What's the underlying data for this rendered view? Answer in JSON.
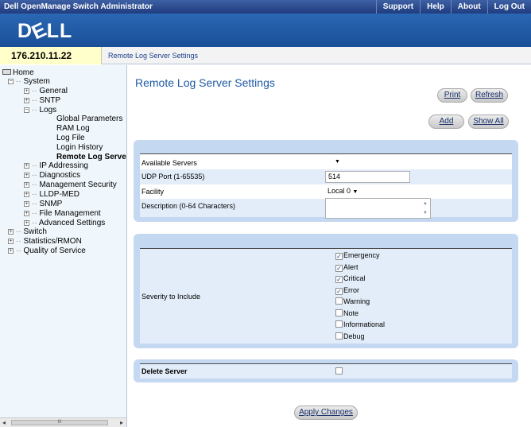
{
  "topbar": {
    "title": "Dell OpenManage Switch Administrator",
    "links": [
      "Support",
      "Help",
      "About",
      "Log Out"
    ]
  },
  "logo": "DELL",
  "ip": "176.210.11.22",
  "breadcrumb": "Remote Log Server Settings",
  "tree": {
    "home": "Home",
    "system": "System",
    "general": "General",
    "sntp": "SNTP",
    "logs": "Logs",
    "global_parameters": "Global Parameters",
    "ram_log": "RAM Log",
    "log_file": "Log File",
    "login_history": "Login History",
    "remote_log_server": "Remote Log Serve",
    "ip_addressing": "IP Addressing",
    "diagnostics": "Diagnostics",
    "management_security": "Management Security",
    "lldp_med": "LLDP-MED",
    "snmp": "SNMP",
    "file_management": "File Management",
    "advanced_settings": "Advanced Settings",
    "switch": "Switch",
    "statistics_rmon": "Statistics/RMON",
    "quality_of_service": "Quality of Service"
  },
  "main": {
    "title": "Remote Log Server Settings",
    "buttons": {
      "print": "Print",
      "refresh": "Refresh",
      "add": "Add",
      "show_all": "Show All",
      "apply": "Apply Changes"
    }
  },
  "form": {
    "available_servers_label": "Available Servers",
    "available_servers_value": "",
    "udp_port_label": "UDP Port (1-65535)",
    "udp_port_value": "514",
    "facility_label": "Facility",
    "facility_value": "Local 0",
    "description_label": "Description (0-64 Characters)",
    "description_value": ""
  },
  "severity": {
    "label": "Severity to Include",
    "items": [
      {
        "name": "Emergency",
        "checked": true
      },
      {
        "name": "Alert",
        "checked": true
      },
      {
        "name": "Critical",
        "checked": true
      },
      {
        "name": "Error",
        "checked": true
      },
      {
        "name": "Warning",
        "checked": false
      },
      {
        "name": "Note",
        "checked": false
      },
      {
        "name": "Informational",
        "checked": false
      },
      {
        "name": "Debug",
        "checked": false
      }
    ]
  },
  "delete": {
    "label": "Delete Server",
    "checked": false
  },
  "scroll": {
    "thumb_label": "III"
  }
}
